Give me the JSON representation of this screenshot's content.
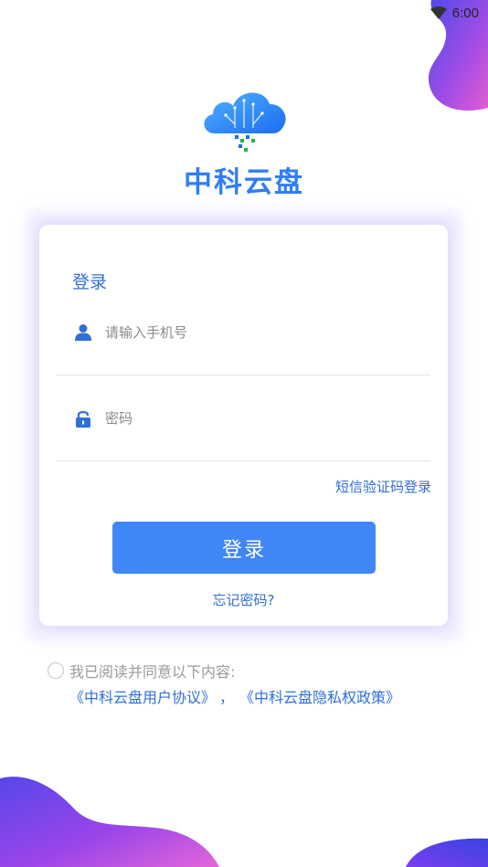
{
  "status_bar": {
    "time": "6:00",
    "icon": "wifi-icon"
  },
  "app": {
    "title": "中科云盘",
    "logo_icon": "cloud-logo-icon"
  },
  "login_card": {
    "heading": "登录",
    "phone": {
      "placeholder": "请输入手机号",
      "value": "",
      "icon": "user-icon"
    },
    "password": {
      "placeholder": "密码",
      "value": "",
      "icon": "lock-icon"
    },
    "sms_login_label": "短信验证码登录",
    "submit_label": "登录",
    "forgot_label": "忘记密码?"
  },
  "agreement": {
    "checked": false,
    "prefix": "我已阅读并同意以下内容:",
    "user_agreement": "《中科云盘用户协议》",
    "separator": "，",
    "privacy_policy": "《中科云盘隐私权政策》"
  },
  "colors": {
    "accent": "#3f86f7",
    "link": "#2f6fd8",
    "blob_purple": "#8b3df0",
    "blob_pink": "#e36fd6"
  }
}
